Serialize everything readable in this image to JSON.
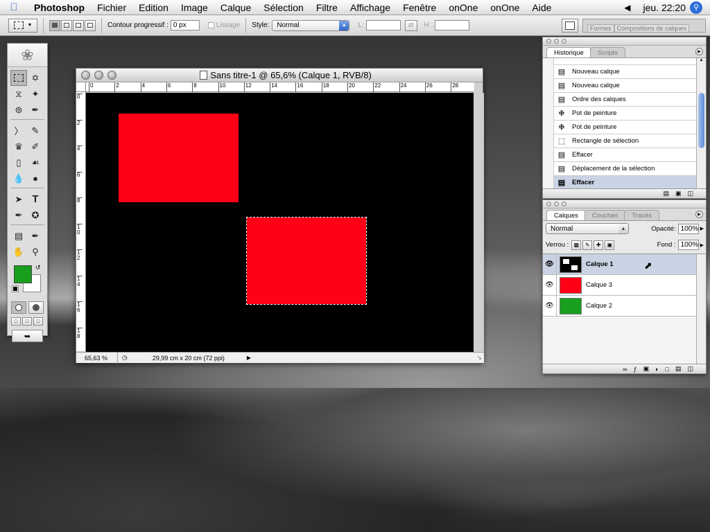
{
  "menubar": {
    "app_name": "Photoshop",
    "items": [
      "Fichier",
      "Edition",
      "Image",
      "Calque",
      "Sélection",
      "Filtre",
      "Affichage",
      "Fenêtre",
      "onOne",
      "onOne",
      "Aide"
    ],
    "clock": "jeu. 22:20"
  },
  "options": {
    "feather_label": "Contour progressif :",
    "feather_value": "0 px",
    "antialias_label": "Lissage",
    "style_label": "Style:",
    "style_value": "Normal",
    "width_label": "L:",
    "height_label": "H :",
    "well_tabs": [
      "Formes",
      "Compositions de calques"
    ]
  },
  "document": {
    "title": "Sans titre-1 @ 65,6% (Calque 1, RVB/8)",
    "zoom": "65,63 %",
    "doc_size": "29,99 cm x 20 cm (72 ppi)",
    "ruler_h": [
      "0",
      "2",
      "4",
      "6",
      "8",
      "10",
      "12",
      "14",
      "16",
      "18",
      "20",
      "22",
      "24",
      "26",
      "28"
    ],
    "ruler_v": [
      "0",
      "2",
      "4",
      "6",
      "8",
      "1 0",
      "1 2",
      "1 4",
      "1 6",
      "1 8"
    ]
  },
  "history": {
    "tabs": [
      "Historique",
      "Scripts"
    ],
    "items": [
      {
        "icon": "doc-icon",
        "label": "Nouveau calque"
      },
      {
        "icon": "doc-icon",
        "label": "Nouveau calque"
      },
      {
        "icon": "doc-icon",
        "label": "Ordre des calques"
      },
      {
        "icon": "bucket-icon",
        "label": "Pot de peinture"
      },
      {
        "icon": "bucket-icon",
        "label": "Pot de peinture"
      },
      {
        "icon": "marquee-icon",
        "label": "Rectangle de sélection"
      },
      {
        "icon": "doc-icon",
        "label": "Effacer"
      },
      {
        "icon": "doc-icon",
        "label": "Déplacement de la sélection"
      },
      {
        "icon": "doc-icon",
        "label": "Effacer"
      }
    ]
  },
  "layers": {
    "tabs": [
      "Calques",
      "Couches",
      "Tracés"
    ],
    "blend_mode": "Normal",
    "opacity_label": "Opacité:",
    "opacity_value": "100%",
    "lock_label": "Verrou :",
    "fill_label": "Fond :",
    "fill_value": "100%",
    "items": [
      {
        "name": "Calque 1",
        "color": "#000000"
      },
      {
        "name": "Calque 3",
        "color": "#ff0017"
      },
      {
        "name": "Calque 2",
        "color": "#179f1d"
      }
    ]
  },
  "colors": {
    "foreground": "#179f1d",
    "background": "#ffffff",
    "red": "#ff0017"
  }
}
